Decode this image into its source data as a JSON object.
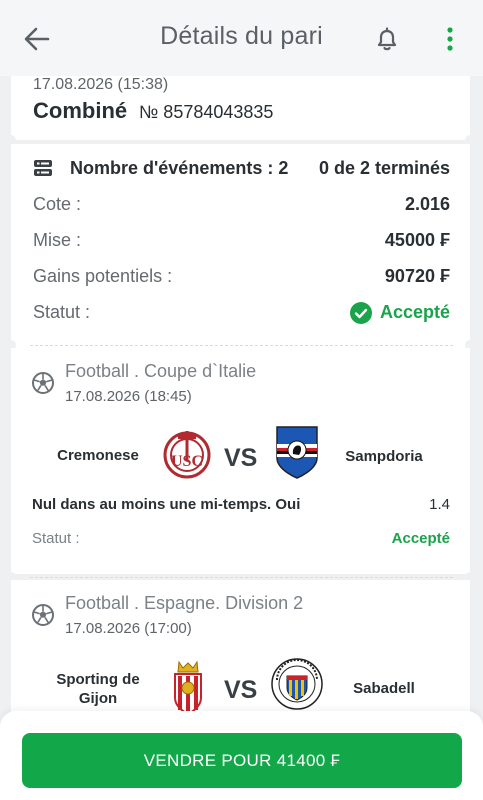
{
  "header": {
    "title": "Détails du pari"
  },
  "bet": {
    "date": "17.08.2026 (15:38)",
    "type": "Combiné",
    "number": "№ 85784043835"
  },
  "summary": {
    "events_label": "Nombre d'événements : 2",
    "events_done": "0 de 2 terminés",
    "odds_label": "Cote :",
    "odds_value": "2.016",
    "stake_label": "Mise :",
    "stake_value": "45000 ₣",
    "winnings_label": "Gains potentiels :",
    "winnings_value": "90720 ₣",
    "status_label": "Statut :",
    "status_value": "Accepté"
  },
  "events": [
    {
      "league": "Football . Coupe d`Italie",
      "date": "17.08.2026 (18:45)",
      "home": "Cremonese",
      "away": "Sampdoria",
      "vs": "VS",
      "bet": "Nul dans au moins une mi-temps. Oui",
      "odd": "1.4",
      "status_label": "Statut :",
      "status_value": "Accepté"
    },
    {
      "league": "Football . Espagne. Division 2",
      "date": "17.08.2026 (17:00)",
      "home": "Sporting de Gijon",
      "away": "Sabadell",
      "vs": "VS"
    }
  ],
  "action": {
    "sell_label": "VENDRE POUR 41400 ₣"
  },
  "colors": {
    "accent": "#12a84a",
    "accepted": "#1aa34a"
  }
}
